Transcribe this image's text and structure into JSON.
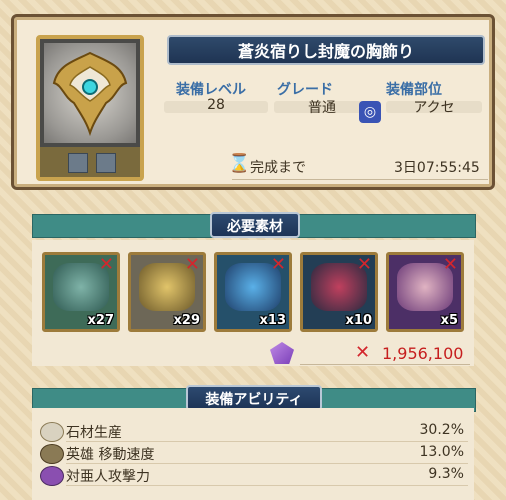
{
  "equipment": {
    "title": "蒼炎宿りし封魔の胸飾り",
    "level_label": "装備レベル",
    "level_value": "28",
    "grade_label": "グレード",
    "grade_value": "普通",
    "slot_label": "装備部位",
    "slot_value": "アクセ",
    "complete_label": "完成まで",
    "complete_time": "3日07:55:45"
  },
  "materials": {
    "header": "必要素材",
    "items": [
      {
        "count": "x27",
        "color": "#4e7a6f"
      },
      {
        "count": "x29",
        "color": "#8a7a55"
      },
      {
        "count": "x13",
        "color": "#2e5a7c"
      },
      {
        "count": "x10",
        "color": "#2a4660"
      },
      {
        "count": "x5",
        "color": "#5e3a7a"
      }
    ],
    "cost": "1,956,100"
  },
  "abilities": {
    "header": "装備アビリティ",
    "rows": [
      {
        "label": "石材生産",
        "value": "30.2%"
      },
      {
        "label": "英雄 移動速度",
        "value": "13.0%"
      },
      {
        "label": "対亜人攻撃力",
        "value": "9.3%"
      }
    ]
  },
  "icons": {
    "slot": "necklace-icon",
    "timer": "hourglass-icon",
    "currency": "crystal-icon",
    "insufficient": "red-x-icon"
  }
}
